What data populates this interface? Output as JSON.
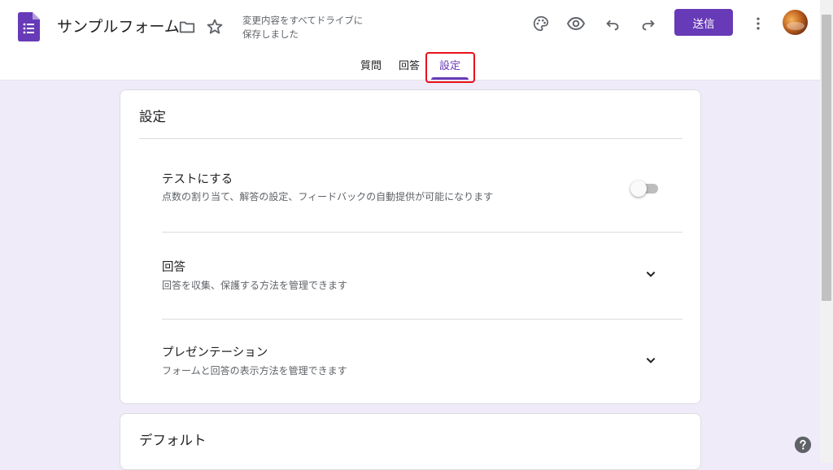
{
  "header": {
    "form_title": "サンプルフォーム",
    "save_status_line1": "変更内容をすべてドライブに",
    "save_status_line2": "保存しました",
    "send_label": "送信",
    "icons": [
      "forms-logo-icon",
      "folder-icon",
      "star-icon",
      "palette-icon",
      "eye-preview-icon",
      "undo-icon",
      "redo-icon",
      "more-vert-icon",
      "avatar"
    ]
  },
  "tabs": [
    {
      "label": "質問",
      "active": false
    },
    {
      "label": "回答",
      "active": false
    },
    {
      "label": "設定",
      "active": true
    }
  ],
  "settings_card": {
    "title": "設定",
    "items": [
      {
        "title": "テストにする",
        "description": "点数の割り当て、解答の設定、フィードバックの自動提供が可能になります",
        "control": "toggle",
        "toggle_on": false
      },
      {
        "title": "回答",
        "description": "回答を収集、保護する方法を管理できます",
        "control": "chevron-down"
      },
      {
        "title": "プレゼンテーション",
        "description": "フォームと回答の表示方法を管理できます",
        "control": "chevron-down"
      }
    ]
  },
  "default_card": {
    "title": "デフォルト"
  },
  "colors": {
    "accent": "#673ab7",
    "page_background": "#f0ebf8",
    "highlight_box": "#e8101a"
  }
}
